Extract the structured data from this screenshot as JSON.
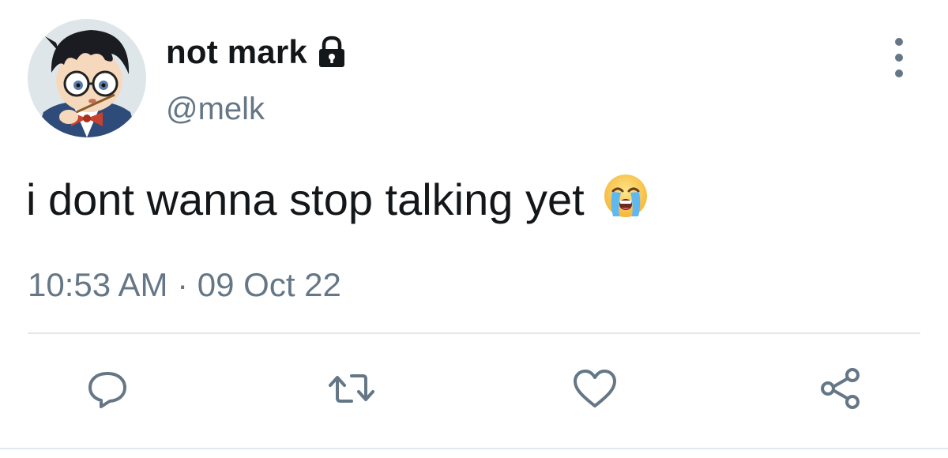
{
  "tweet": {
    "display_name": "not mark",
    "handle": "@melk",
    "text": "i dont wanna stop talking yet",
    "emoji": "loudly-crying-face",
    "timestamp": "10:53 AM · 09 Oct 22",
    "protected_icon": "lock-icon",
    "avatar": "anime-boy-with-glasses-avatar"
  },
  "actions": {
    "reply": "reply-icon",
    "retweet": "retweet-icon",
    "like": "heart-icon",
    "share": "share-icon"
  },
  "menu_icon": "more-vertical-icon",
  "colors": {
    "text_primary": "#14171a",
    "text_secondary": "#657786",
    "divider": "#e1e8ed"
  }
}
